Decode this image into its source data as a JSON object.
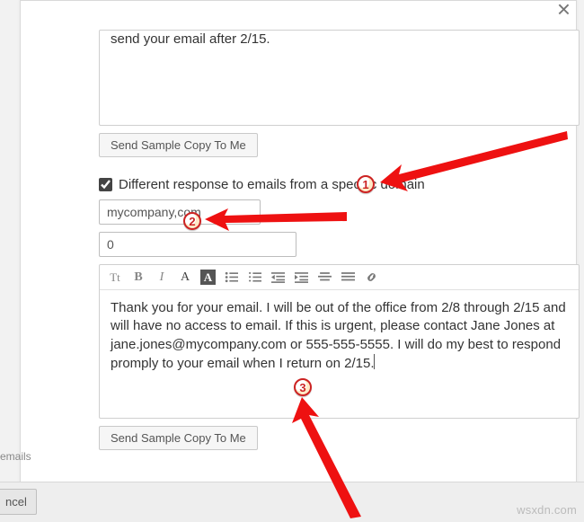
{
  "close_glyph": "×",
  "top_editor_text": "send your email after 2/15.",
  "send_sample_btn": "Send Sample Copy To Me",
  "checkbox_label": "Different response to emails from a specific domain",
  "domain_input_value": "mycompany,com",
  "number_input_value": "0",
  "large_editor_text": "Thank you for your email. I will be out of the office from 2/8 through 2/15 and will have no access to email. If this is urgent, please contact Jane Jones at jane.jones@mycompany.com or 555-555-5555. I will do my best to respond promply to your email when I return on 2/15.",
  "cancel_btn": "ncel",
  "emails_label": "emails",
  "watermark": "wsxdn.com",
  "callouts": {
    "one": "1",
    "two": "2",
    "three": "3"
  },
  "toolbar": {
    "tt": "Tt",
    "bold": "B",
    "italic": "I",
    "font": "A",
    "highlight": "A"
  }
}
